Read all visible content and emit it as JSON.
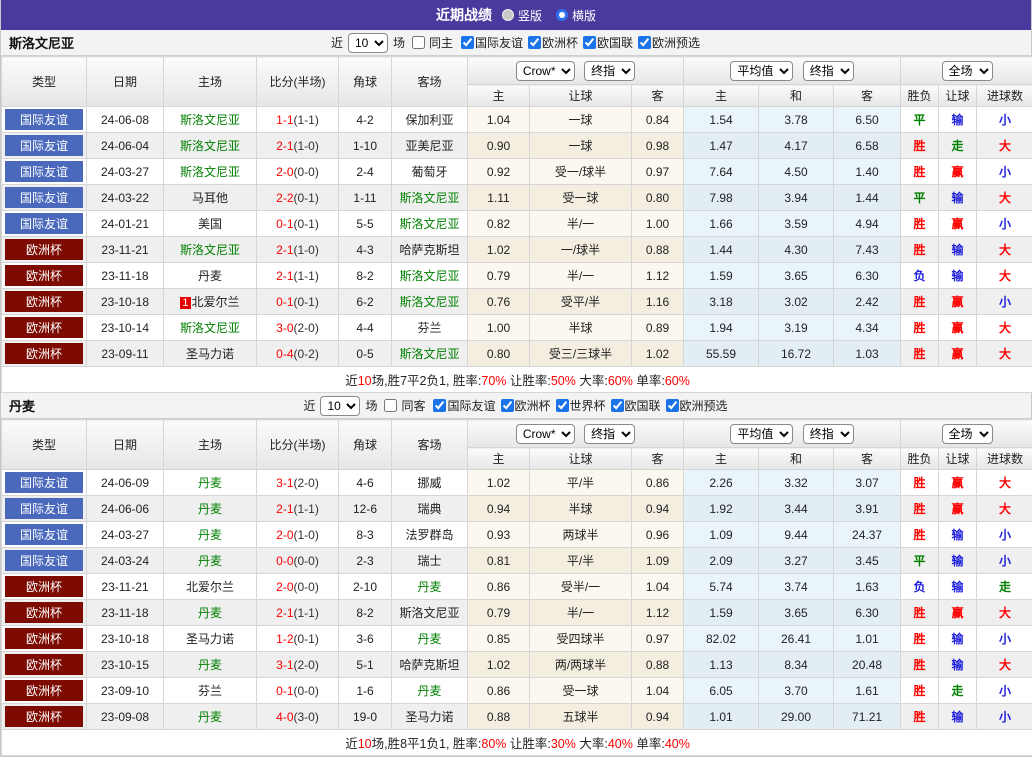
{
  "topbar": {
    "title": "近期战绩",
    "vertical_label": "竖版",
    "horizontal_label": "横版"
  },
  "hdr": {
    "type": "类型",
    "date": "日期",
    "home": "主场",
    "score": "比分(半场)",
    "corner": "角球",
    "away": "客场",
    "home_odds": "主",
    "handicap": "让球",
    "away_odds": "客",
    "avg_home": "主",
    "avg_draw": "和",
    "avg_away": "客",
    "result": "胜负",
    "handicap_result": "让球",
    "goals": "进球数",
    "crow_select": "Crow*",
    "final_select": "终指",
    "avg_select": "平均值",
    "final_select2": "终指",
    "full_select": "全场",
    "recent_label": "近",
    "games_label": "场"
  },
  "colors": {
    "topbar_bg": "#4a3a9e",
    "league_blue": "#4a69bd",
    "league_maroon": "#7d0b02",
    "team_green": "#008000",
    "win_red": "#ff0000",
    "lose_blue": "#2020dd",
    "draw_green": "#008000"
  },
  "sections": [
    {
      "team": "斯洛文尼亚",
      "filter": {
        "count": "10",
        "same": "同主",
        "same_checked": false,
        "leagues": [
          "国际友谊",
          "欧洲杯",
          "欧国联",
          "欧洲预选"
        ]
      },
      "rows": [
        {
          "league": "国际友谊",
          "lc": "blue",
          "date": "24-06-08",
          "home": "斯洛文尼亚",
          "hg": true,
          "score": "1-1",
          "half": "(1-1)",
          "corners": "4-2",
          "away": "保加利亚",
          "ag": false,
          "ch": "1.04",
          "line": "一球",
          "ca": "0.84",
          "ah": "1.54",
          "ad": "3.78",
          "aa": "6.50",
          "r1": "平",
          "r1c": "g",
          "r2": "输",
          "r2c": "b",
          "r3": "小",
          "r3c": "b"
        },
        {
          "league": "国际友谊",
          "lc": "blue",
          "date": "24-06-04",
          "home": "斯洛文尼亚",
          "hg": true,
          "score": "2-1",
          "half": "(1-0)",
          "corners": "1-10",
          "away": "亚美尼亚",
          "ag": false,
          "ch": "0.90",
          "line": "一球",
          "ca": "0.98",
          "ah": "1.47",
          "ad": "4.17",
          "aa": "6.58",
          "r1": "胜",
          "r1c": "r",
          "r2": "走",
          "r2c": "g",
          "r3": "大",
          "r3c": "r"
        },
        {
          "league": "国际友谊",
          "lc": "blue",
          "date": "24-03-27",
          "home": "斯洛文尼亚",
          "hg": true,
          "score": "2-0",
          "half": "(0-0)",
          "corners": "2-4",
          "away": "葡萄牙",
          "ag": false,
          "ch": "0.92",
          "line": "受一/球半",
          "ca": "0.97",
          "ah": "7.64",
          "ad": "4.50",
          "aa": "1.40",
          "r1": "胜",
          "r1c": "r",
          "r2": "赢",
          "r2c": "r",
          "r3": "小",
          "r3c": "b"
        },
        {
          "league": "国际友谊",
          "lc": "blue",
          "date": "24-03-22",
          "home": "马耳他",
          "hg": false,
          "score": "2-2",
          "half": "(0-1)",
          "corners": "1-11",
          "away": "斯洛文尼亚",
          "ag": true,
          "ch": "1.11",
          "line": "受一球",
          "ca": "0.80",
          "ah": "7.98",
          "ad": "3.94",
          "aa": "1.44",
          "r1": "平",
          "r1c": "g",
          "r2": "输",
          "r2c": "b",
          "r3": "大",
          "r3c": "r"
        },
        {
          "league": "国际友谊",
          "lc": "blue",
          "date": "24-01-21",
          "home": "美国",
          "hg": false,
          "score": "0-1",
          "half": "(0-1)",
          "corners": "5-5",
          "away": "斯洛文尼亚",
          "ag": true,
          "ch": "0.82",
          "line": "半/一",
          "ca": "1.00",
          "ah": "1.66",
          "ad": "3.59",
          "aa": "4.94",
          "r1": "胜",
          "r1c": "r",
          "r2": "赢",
          "r2c": "r",
          "r3": "小",
          "r3c": "b"
        },
        {
          "league": "欧洲杯",
          "lc": "maroon",
          "date": "23-11-21",
          "home": "斯洛文尼亚",
          "hg": true,
          "score": "2-1",
          "half": "(1-0)",
          "corners": "4-3",
          "away": "哈萨克斯坦",
          "ag": false,
          "ch": "1.02",
          "line": "一/球半",
          "ca": "0.88",
          "ah": "1.44",
          "ad": "4.30",
          "aa": "7.43",
          "r1": "胜",
          "r1c": "r",
          "r2": "输",
          "r2c": "b",
          "r3": "大",
          "r3c": "r"
        },
        {
          "league": "欧洲杯",
          "lc": "maroon",
          "date": "23-11-18",
          "home": "丹麦",
          "hg": false,
          "score": "2-1",
          "half": "(1-1)",
          "corners": "8-2",
          "away": "斯洛文尼亚",
          "ag": true,
          "ch": "0.79",
          "line": "半/一",
          "ca": "1.12",
          "ah": "1.59",
          "ad": "3.65",
          "aa": "6.30",
          "r1": "负",
          "r1c": "b",
          "r2": "输",
          "r2c": "b",
          "r3": "大",
          "r3c": "r"
        },
        {
          "league": "欧洲杯",
          "lc": "maroon",
          "date": "23-10-18",
          "home": "北爱尔兰",
          "hg": false,
          "home_badge": "1",
          "score": "0-1",
          "half": "(0-1)",
          "corners": "6-2",
          "away": "斯洛文尼亚",
          "ag": true,
          "ch": "0.76",
          "line": "受平/半",
          "ca": "1.16",
          "ah": "3.18",
          "ad": "3.02",
          "aa": "2.42",
          "r1": "胜",
          "r1c": "r",
          "r2": "赢",
          "r2c": "r",
          "r3": "小",
          "r3c": "b"
        },
        {
          "league": "欧洲杯",
          "lc": "maroon",
          "date": "23-10-14",
          "home": "斯洛文尼亚",
          "hg": true,
          "score": "3-0",
          "half": "(2-0)",
          "corners": "4-4",
          "away": "芬兰",
          "ag": false,
          "ch": "1.00",
          "line": "半球",
          "ca": "0.89",
          "ah": "1.94",
          "ad": "3.19",
          "aa": "4.34",
          "r1": "胜",
          "r1c": "r",
          "r2": "赢",
          "r2c": "r",
          "r3": "大",
          "r3c": "r"
        },
        {
          "league": "欧洲杯",
          "lc": "maroon",
          "date": "23-09-11",
          "home": "圣马力诺",
          "hg": false,
          "score": "0-4",
          "half": "(0-2)",
          "corners": "0-5",
          "away": "斯洛文尼亚",
          "ag": true,
          "ch": "0.80",
          "line": "受三/三球半",
          "ca": "1.02",
          "ah": "55.59",
          "ad": "16.72",
          "aa": "1.03",
          "r1": "胜",
          "r1c": "r",
          "r2": "赢",
          "r2c": "r",
          "r3": "大",
          "r3c": "r"
        }
      ],
      "summary": [
        {
          "t": "近",
          "c": "k"
        },
        {
          "t": "10",
          "c": "r"
        },
        {
          "t": "场,胜7平2负1, 胜率:",
          "c": "k"
        },
        {
          "t": "70%",
          "c": "r"
        },
        {
          "t": " 让胜率:",
          "c": "k"
        },
        {
          "t": "50%",
          "c": "r"
        },
        {
          "t": " 大率:",
          "c": "k"
        },
        {
          "t": "60%",
          "c": "r"
        },
        {
          "t": " 单率:",
          "c": "k"
        },
        {
          "t": "60%",
          "c": "r"
        }
      ]
    },
    {
      "team": "丹麦",
      "filter": {
        "count": "10",
        "same": "同客",
        "same_checked": false,
        "leagues": [
          "国际友谊",
          "欧洲杯",
          "世界杯",
          "欧国联",
          "欧洲预选"
        ]
      },
      "rows": [
        {
          "league": "国际友谊",
          "lc": "blue",
          "date": "24-06-09",
          "home": "丹麦",
          "hg": true,
          "score": "3-1",
          "half": "(2-0)",
          "corners": "4-6",
          "away": "挪威",
          "ag": false,
          "ch": "1.02",
          "line": "平/半",
          "ca": "0.86",
          "ah": "2.26",
          "ad": "3.32",
          "aa": "3.07",
          "r1": "胜",
          "r1c": "r",
          "r2": "赢",
          "r2c": "r",
          "r3": "大",
          "r3c": "r"
        },
        {
          "league": "国际友谊",
          "lc": "blue",
          "date": "24-06-06",
          "home": "丹麦",
          "hg": true,
          "score": "2-1",
          "half": "(1-1)",
          "corners": "12-6",
          "away": "瑞典",
          "ag": false,
          "ch": "0.94",
          "line": "半球",
          "ca": "0.94",
          "ah": "1.92",
          "ad": "3.44",
          "aa": "3.91",
          "r1": "胜",
          "r1c": "r",
          "r2": "赢",
          "r2c": "r",
          "r3": "大",
          "r3c": "r"
        },
        {
          "league": "国际友谊",
          "lc": "blue",
          "date": "24-03-27",
          "home": "丹麦",
          "hg": true,
          "score": "2-0",
          "half": "(1-0)",
          "corners": "8-3",
          "away": "法罗群岛",
          "ag": false,
          "ch": "0.93",
          "line": "两球半",
          "ca": "0.96",
          "ah": "1.09",
          "ad": "9.44",
          "aa": "24.37",
          "r1": "胜",
          "r1c": "r",
          "r2": "输",
          "r2c": "b",
          "r3": "小",
          "r3c": "b"
        },
        {
          "league": "国际友谊",
          "lc": "blue",
          "date": "24-03-24",
          "home": "丹麦",
          "hg": true,
          "score": "0-0",
          "half": "(0-0)",
          "corners": "2-3",
          "away": "瑞士",
          "ag": false,
          "ch": "0.81",
          "line": "平/半",
          "ca": "1.09",
          "ah": "2.09",
          "ad": "3.27",
          "aa": "3.45",
          "r1": "平",
          "r1c": "g",
          "r2": "输",
          "r2c": "b",
          "r3": "小",
          "r3c": "b"
        },
        {
          "league": "欧洲杯",
          "lc": "maroon",
          "date": "23-11-21",
          "home": "北爱尔兰",
          "hg": false,
          "score": "2-0",
          "half": "(0-0)",
          "corners": "2-10",
          "away": "丹麦",
          "ag": true,
          "ch": "0.86",
          "line": "受半/一",
          "ca": "1.04",
          "ah": "5.74",
          "ad": "3.74",
          "aa": "1.63",
          "r1": "负",
          "r1c": "b",
          "r2": "输",
          "r2c": "b",
          "r3": "走",
          "r3c": "g"
        },
        {
          "league": "欧洲杯",
          "lc": "maroon",
          "date": "23-11-18",
          "home": "丹麦",
          "hg": true,
          "score": "2-1",
          "half": "(1-1)",
          "corners": "8-2",
          "away": "斯洛文尼亚",
          "ag": false,
          "ch": "0.79",
          "line": "半/一",
          "ca": "1.12",
          "ah": "1.59",
          "ad": "3.65",
          "aa": "6.30",
          "r1": "胜",
          "r1c": "r",
          "r2": "赢",
          "r2c": "r",
          "r3": "大",
          "r3c": "r"
        },
        {
          "league": "欧洲杯",
          "lc": "maroon",
          "date": "23-10-18",
          "home": "圣马力诺",
          "hg": false,
          "score": "1-2",
          "half": "(0-1)",
          "corners": "3-6",
          "away": "丹麦",
          "ag": true,
          "ch": "0.85",
          "line": "受四球半",
          "ca": "0.97",
          "ah": "82.02",
          "ad": "26.41",
          "aa": "1.01",
          "r1": "胜",
          "r1c": "r",
          "r2": "输",
          "r2c": "b",
          "r3": "小",
          "r3c": "b"
        },
        {
          "league": "欧洲杯",
          "lc": "maroon",
          "date": "23-10-15",
          "home": "丹麦",
          "hg": true,
          "score": "3-1",
          "half": "(2-0)",
          "corners": "5-1",
          "away": "哈萨克斯坦",
          "ag": false,
          "ch": "1.02",
          "line": "两/两球半",
          "ca": "0.88",
          "ah": "1.13",
          "ad": "8.34",
          "aa": "20.48",
          "r1": "胜",
          "r1c": "r",
          "r2": "输",
          "r2c": "b",
          "r3": "大",
          "r3c": "r"
        },
        {
          "league": "欧洲杯",
          "lc": "maroon",
          "date": "23-09-10",
          "home": "芬兰",
          "hg": false,
          "score": "0-1",
          "half": "(0-0)",
          "corners": "1-6",
          "away": "丹麦",
          "ag": true,
          "ch": "0.86",
          "line": "受一球",
          "ca": "1.04",
          "ah": "6.05",
          "ad": "3.70",
          "aa": "1.61",
          "r1": "胜",
          "r1c": "r",
          "r2": "走",
          "r2c": "g",
          "r3": "小",
          "r3c": "b"
        },
        {
          "league": "欧洲杯",
          "lc": "maroon",
          "date": "23-09-08",
          "home": "丹麦",
          "hg": true,
          "score": "4-0",
          "half": "(3-0)",
          "corners": "19-0",
          "away": "圣马力诺",
          "ag": false,
          "ch": "0.88",
          "line": "五球半",
          "ca": "0.94",
          "ah": "1.01",
          "ad": "29.00",
          "aa": "71.21",
          "r1": "胜",
          "r1c": "r",
          "r2": "输",
          "r2c": "b",
          "r3": "小",
          "r3c": "b"
        }
      ],
      "summary": [
        {
          "t": "近",
          "c": "k"
        },
        {
          "t": "10",
          "c": "r"
        },
        {
          "t": "场,胜8平1负1, 胜率:",
          "c": "k"
        },
        {
          "t": "80%",
          "c": "r"
        },
        {
          "t": " 让胜率:",
          "c": "k"
        },
        {
          "t": "30%",
          "c": "r"
        },
        {
          "t": " 大率:",
          "c": "k"
        },
        {
          "t": "40%",
          "c": "r"
        },
        {
          "t": " 单率:",
          "c": "k"
        },
        {
          "t": "40%",
          "c": "r"
        }
      ]
    }
  ]
}
